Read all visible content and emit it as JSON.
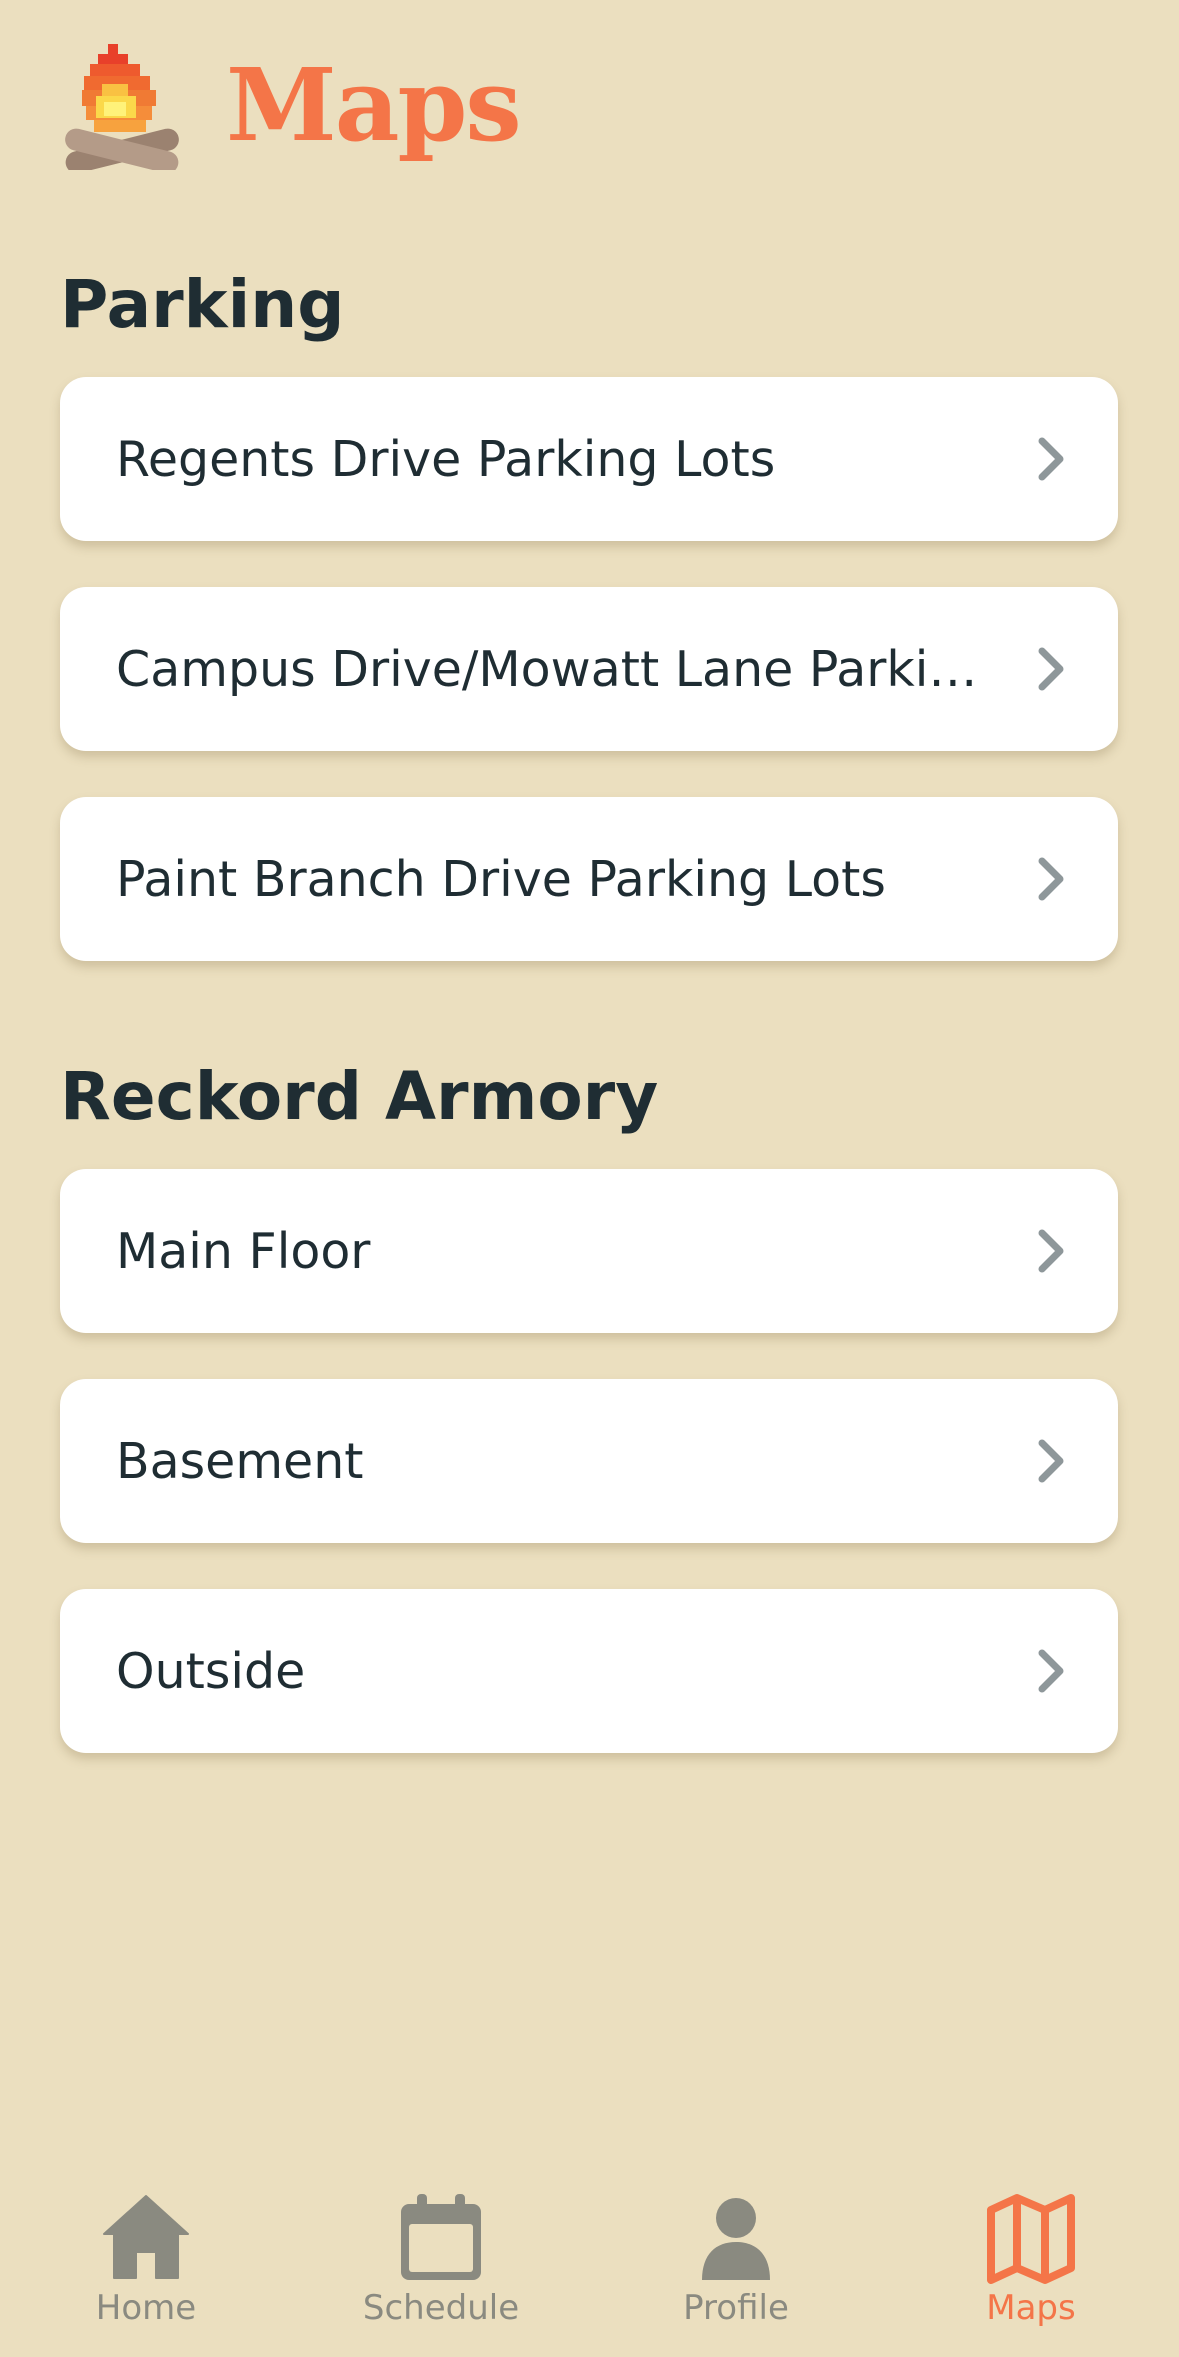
{
  "header": {
    "title": "Maps",
    "logo_icon": "campfire-icon"
  },
  "sections": [
    {
      "title": "Parking",
      "items": [
        {
          "label": "Regents Drive Parking Lots"
        },
        {
          "label": "Campus Drive/Mowatt Lane Parking Lots"
        },
        {
          "label": "Paint Branch Drive Parking Lots"
        }
      ]
    },
    {
      "title": "Reckord Armory",
      "items": [
        {
          "label": "Main Floor"
        },
        {
          "label": "Basement"
        },
        {
          "label": "Outside"
        }
      ]
    }
  ],
  "tabbar": {
    "tabs": [
      {
        "label": "Home",
        "icon": "home-icon",
        "active": false
      },
      {
        "label": "Schedule",
        "icon": "calendar-icon",
        "active": false
      },
      {
        "label": "Profile",
        "icon": "person-icon",
        "active": false
      },
      {
        "label": "Maps",
        "icon": "map-icon",
        "active": true
      }
    ]
  },
  "colors": {
    "background": "#ebdfbf",
    "accent": "#f47548",
    "text": "#1f2d33",
    "inactive_tab": "#8a8a80",
    "chevron": "#8e979a"
  }
}
